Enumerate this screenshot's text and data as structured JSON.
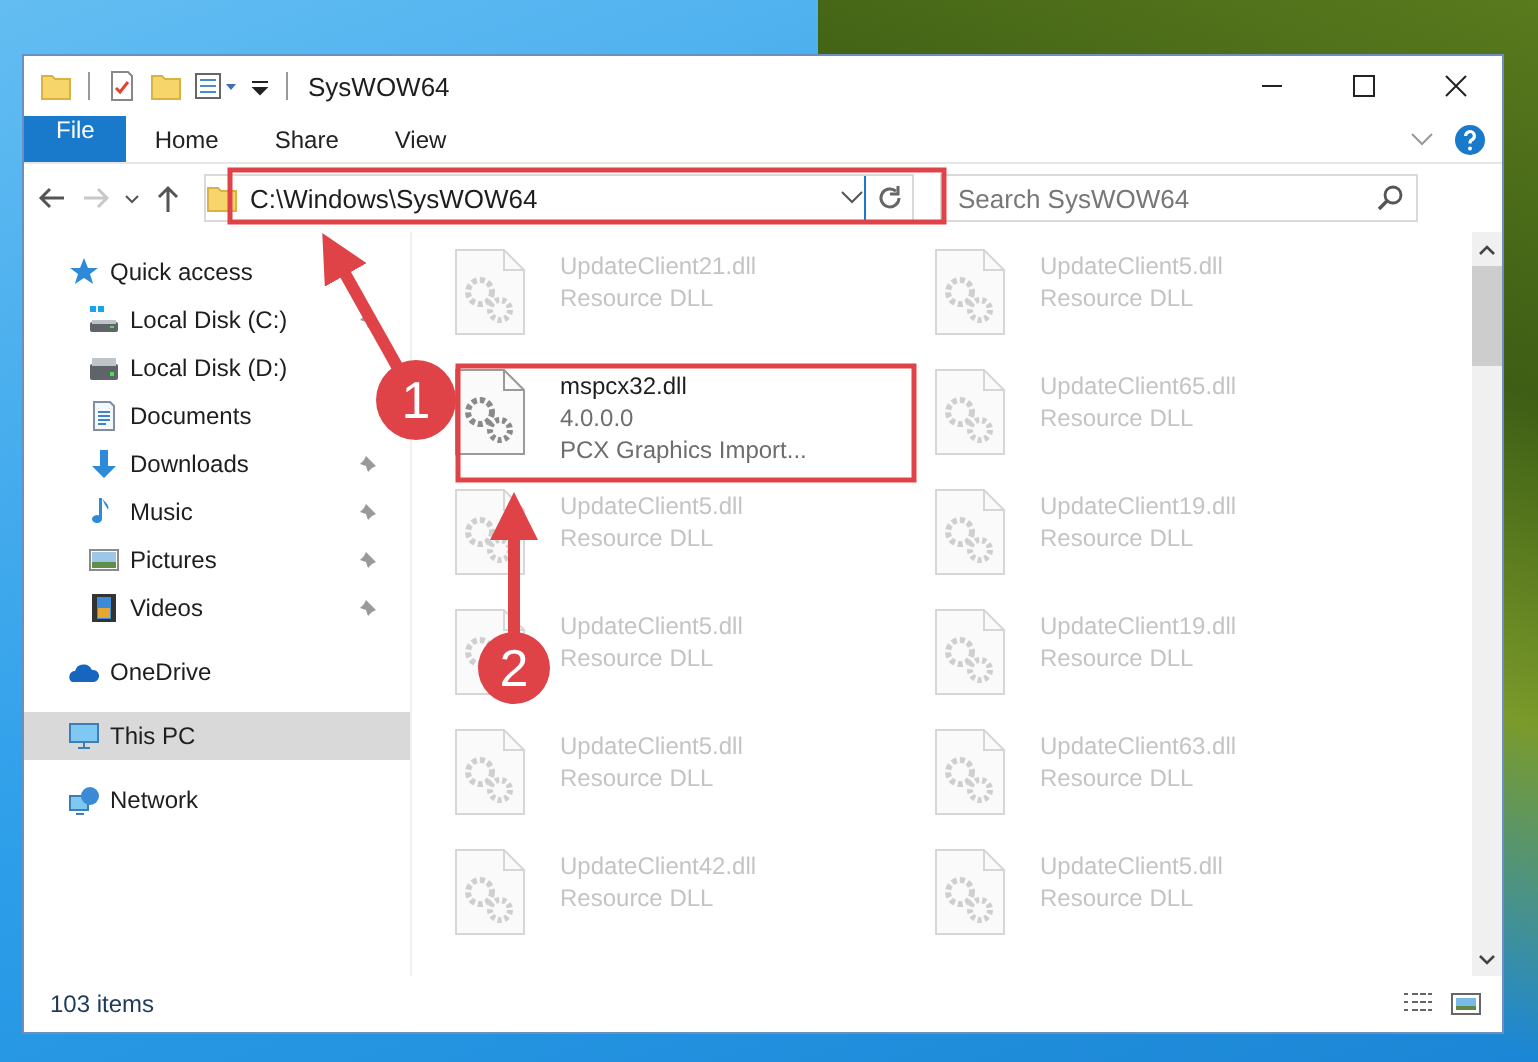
{
  "window": {
    "title": "SysWOW64"
  },
  "ribbon": {
    "tabs": [
      {
        "label": "File",
        "kind": "file"
      },
      {
        "label": "Home",
        "kind": "tab"
      },
      {
        "label": "Share",
        "kind": "tab"
      },
      {
        "label": "View",
        "kind": "tab"
      }
    ]
  },
  "navigation": {
    "forward_disabled": true,
    "address": "C:\\Windows\\SysWOW64",
    "search": {
      "placeholder": "Search SysWOW64"
    }
  },
  "sidebar": {
    "items": [
      {
        "label": "Quick access",
        "kind": "star",
        "selected": false,
        "children": [
          {
            "label": "Local Disk (C:)",
            "kind": "drive-c",
            "pinned": true
          },
          {
            "label": "Local Disk (D:)",
            "kind": "drive",
            "pinned": false
          },
          {
            "label": "Documents",
            "kind": "documents",
            "pinned": false
          },
          {
            "label": "Downloads",
            "kind": "downloads",
            "pinned": true
          },
          {
            "label": "Music",
            "kind": "music",
            "pinned": true
          },
          {
            "label": "Pictures",
            "kind": "pictures",
            "pinned": true
          },
          {
            "label": "Videos",
            "kind": "videos",
            "pinned": true
          }
        ]
      },
      {
        "label": "OneDrive",
        "kind": "onedrive",
        "selected": false
      },
      {
        "label": "This PC",
        "kind": "pc",
        "selected": true
      },
      {
        "label": "Network",
        "kind": "network",
        "selected": false
      }
    ]
  },
  "files": [
    {
      "name": "UpdateClient21.dll",
      "lines": [
        "Resource DLL"
      ],
      "faded": true
    },
    {
      "name": "UpdateClient5.dll",
      "lines": [
        "Resource DLL"
      ],
      "faded": true
    },
    {
      "name": "mspcx32.dll",
      "lines": [
        "4.0.0.0",
        "PCX Graphics Import..."
      ],
      "faded": false
    },
    {
      "name": "UpdateClient65.dll",
      "lines": [
        "Resource DLL"
      ],
      "faded": true
    },
    {
      "name": "UpdateClient5.dll",
      "lines": [
        "Resource DLL"
      ],
      "faded": true
    },
    {
      "name": "UpdateClient19.dll",
      "lines": [
        "Resource DLL"
      ],
      "faded": true
    },
    {
      "name": "UpdateClient5.dll",
      "lines": [
        "Resource DLL"
      ],
      "faded": true
    },
    {
      "name": "UpdateClient19.dll",
      "lines": [
        "Resource DLL"
      ],
      "faded": true
    },
    {
      "name": "UpdateClient5.dll",
      "lines": [
        "Resource DLL"
      ],
      "faded": true
    },
    {
      "name": "UpdateClient63.dll",
      "lines": [
        "Resource DLL"
      ],
      "faded": true
    },
    {
      "name": "UpdateClient42.dll",
      "lines": [
        "Resource DLL"
      ],
      "faded": true
    },
    {
      "name": "UpdateClient5.dll",
      "lines": [
        "Resource DLL"
      ],
      "faded": true
    }
  ],
  "status_bar": {
    "count": "103 items"
  },
  "annotations": [
    {
      "number": "1"
    },
    {
      "number": "2"
    }
  ]
}
